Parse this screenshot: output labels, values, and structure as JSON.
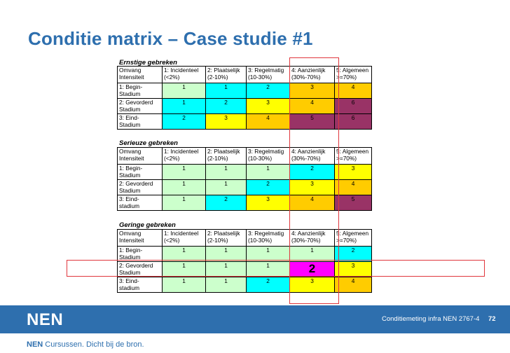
{
  "title": "Conditie matrix – Case studie #1",
  "headers": [
    "Omvang\nIntensiteit",
    "1: Incidenteel\n(<2%)",
    "2: Plaatselijk\n(2-10%)",
    "3: Regelmatig\n(10-30%)",
    "4: Aanzienlijk\n(30%-70%)",
    "5: Algemeen\n>=70%)"
  ],
  "sections": [
    {
      "title": "Ernstige gebreken",
      "rows": [
        {
          "label": "1: Begin-\nStadium",
          "values": [
            "1",
            "1",
            "2",
            "3",
            "4"
          ],
          "colors": [
            "#ccffcc",
            "#00ffff",
            "#00ffff",
            "#ffcc00",
            "#ffcc00"
          ]
        },
        {
          "label": "2: Gevorderd\nStadium",
          "values": [
            "1",
            "2",
            "3",
            "4",
            "6"
          ],
          "colors": [
            "#00ffff",
            "#00ffff",
            "#ffff00",
            "#ffcc00",
            "#993366"
          ]
        },
        {
          "label": "3: Eind-\nStadium",
          "values": [
            "2",
            "3",
            "4",
            "5",
            "6"
          ],
          "colors": [
            "#00ffff",
            "#ffff00",
            "#ffcc00",
            "#993366",
            "#993366"
          ]
        }
      ]
    },
    {
      "title": "Serieuze gebreken",
      "rows": [
        {
          "label": "1: Begin-\nStadium",
          "values": [
            "1",
            "1",
            "1",
            "2",
            "3"
          ],
          "colors": [
            "#ccffcc",
            "#ccffcc",
            "#ccffcc",
            "#00ffff",
            "#ffff00"
          ]
        },
        {
          "label": "2: Gevorderd\nStadium",
          "values": [
            "1",
            "1",
            "2",
            "3",
            "4"
          ],
          "colors": [
            "#ccffcc",
            "#ccffcc",
            "#00ffff",
            "#ffff00",
            "#ffcc00"
          ]
        },
        {
          "label": "3: Eind-\nstadium",
          "values": [
            "1",
            "2",
            "3",
            "4",
            "5"
          ],
          "colors": [
            "#ccffcc",
            "#00ffff",
            "#ffff00",
            "#ffcc00",
            "#993366"
          ]
        }
      ]
    },
    {
      "title": "Geringe gebreken",
      "rows": [
        {
          "label": "1: Begin-\nStadium",
          "values": [
            "1",
            "1",
            "1",
            "1",
            "2"
          ],
          "colors": [
            "#ccffcc",
            "#ccffcc",
            "#ccffcc",
            "#ccffcc",
            "#00ffff"
          ]
        },
        {
          "label": "2: Gevorderd\nStadium",
          "values": [
            "1",
            "1",
            "1",
            "2",
            "3"
          ],
          "colors": [
            "#ccffcc",
            "#ccffcc",
            "#ccffcc",
            "#ff00ff",
            "#ffff00"
          ]
        },
        {
          "label": "3: Eind-\nstadium",
          "values": [
            "1",
            "1",
            "2",
            "3",
            "4"
          ],
          "colors": [
            "#ccffcc",
            "#ccffcc",
            "#00ffff",
            "#ffff00",
            "#ffcc00"
          ]
        }
      ]
    }
  ],
  "highlight_color": "#e0363c",
  "brand_color": "#2e6fae",
  "footer": {
    "logo": "NEN",
    "text": "Conditiemeting infra NEN 2767-4",
    "page": "72"
  },
  "tagline": {
    "brand": "NEN",
    "rest": "Cursussen. Dicht bij de bron."
  }
}
